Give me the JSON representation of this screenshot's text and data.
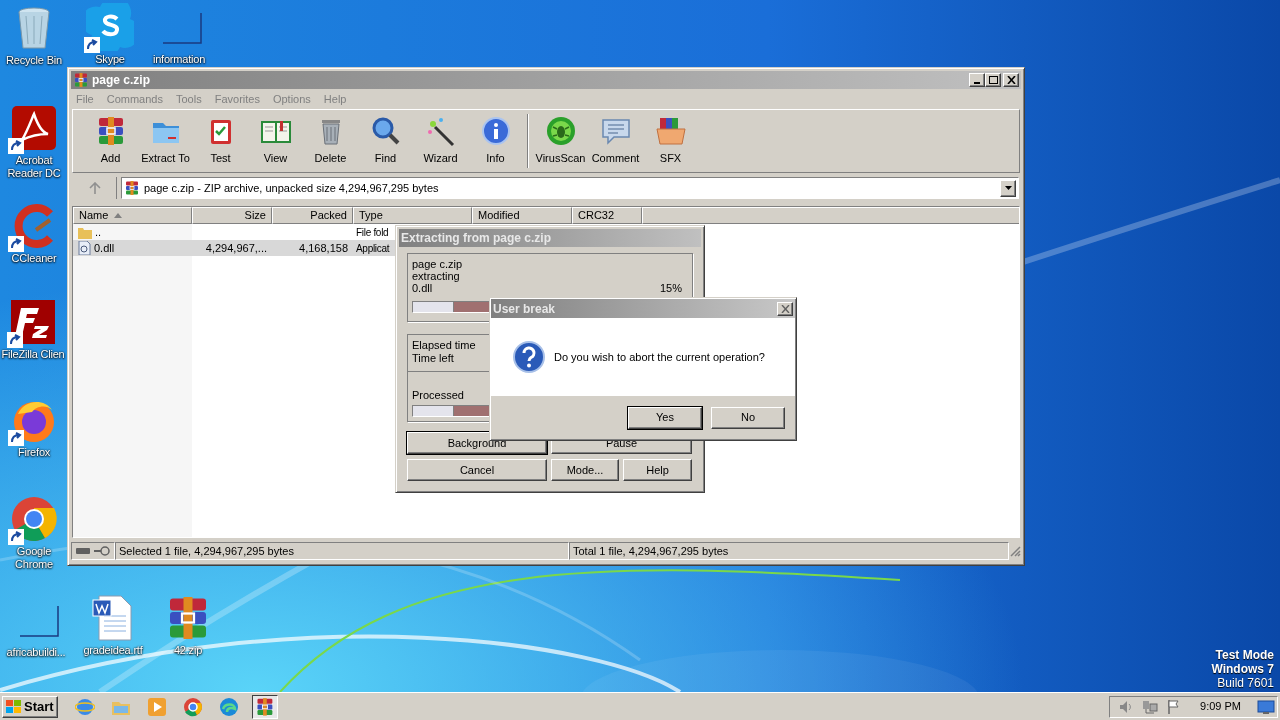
{
  "desktop_icons": [
    {
      "label": "Recycle Bin",
      "kind": "recycle",
      "shortcut": false
    },
    {
      "label": "Skype",
      "kind": "skype",
      "shortcut": true
    },
    {
      "label": "information",
      "kind": "blank",
      "shortcut": false
    },
    {
      "label": "Acrobat Reader DC",
      "kind": "acrobat",
      "shortcut": true
    },
    {
      "label": "CCleaner",
      "kind": "ccleaner",
      "shortcut": true
    },
    {
      "label": "FileZilla Clien",
      "kind": "filezilla",
      "shortcut": true
    },
    {
      "label": "Firefox",
      "kind": "firefox",
      "shortcut": true
    },
    {
      "label": "Google Chrome",
      "kind": "chrome",
      "shortcut": true
    },
    {
      "label": "africabuildi...",
      "kind": "blank",
      "shortcut": false
    },
    {
      "label": "gradeidea.rtf",
      "kind": "word",
      "shortcut": false
    },
    {
      "label": "42.zip",
      "kind": "winrar",
      "shortcut": false
    }
  ],
  "system_notice": [
    "Test Mode",
    "Windows 7",
    "Build 7601"
  ],
  "window": {
    "title": "page c.zip",
    "menu": [
      {
        "label": "File",
        "disabled": true
      },
      {
        "label": "Commands",
        "disabled": true
      },
      {
        "label": "Tools",
        "disabled": true
      },
      {
        "label": "Favorites",
        "disabled": true
      },
      {
        "label": "Options",
        "disabled": true
      },
      {
        "label": "Help",
        "disabled": true
      }
    ],
    "toolbar": [
      {
        "label": "Add",
        "kind": "add"
      },
      {
        "label": "Extract To",
        "kind": "extract"
      },
      {
        "label": "Test",
        "kind": "test"
      },
      {
        "label": "View",
        "kind": "view"
      },
      {
        "label": "Delete",
        "kind": "delete"
      },
      {
        "label": "Find",
        "kind": "find"
      },
      {
        "label": "Wizard",
        "kind": "wizard"
      },
      {
        "label": "Info",
        "kind": "info"
      },
      {
        "kind": "separator"
      },
      {
        "label": "VirusScan",
        "kind": "virus"
      },
      {
        "label": "Comment",
        "kind": "comment"
      },
      {
        "label": "SFX",
        "kind": "sfx"
      }
    ],
    "address": "page c.zip - ZIP archive, unpacked size 4,294,967,295 bytes",
    "table": {
      "columns": [
        {
          "label": "Name",
          "sorted": true
        },
        {
          "label": "Size",
          "sorted": false
        },
        {
          "label": "Packed",
          "sorted": false
        },
        {
          "label": "Type",
          "sorted": false
        },
        {
          "label": "Modified",
          "sorted": false
        },
        {
          "label": "CRC32",
          "sorted": false
        }
      ],
      "rows": [
        {
          "kind": "folder",
          "selected": false,
          "cells": [
            "..",
            "",
            "",
            "File fold"
          ]
        },
        {
          "kind": "file",
          "selected": true,
          "cells": [
            "0.dll",
            "4,294,967,...",
            "4,168,158",
            "Applicat"
          ]
        }
      ]
    },
    "status_bar": [
      "Selected 1 file, 4,294,967,295 bytes",
      "Total 1 file, 4,294,967,295 bytes"
    ]
  },
  "extract_dialog": {
    "title": "Extracting from page c.zip",
    "lines": [
      "page c.zip",
      "extracting",
      "0.dll"
    ],
    "percent": "15%",
    "file_progress": {
      "level": 0.15
    },
    "time_labels": [
      "Elapsed time",
      "Time left"
    ],
    "processed": {
      "label": "Processed",
      "level": 0.15
    },
    "buttons": [
      {
        "label": "Background",
        "default": true
      },
      {
        "label": "Pause",
        "default": false
      },
      {
        "label": "Cancel",
        "default": false
      },
      {
        "label": "Mode...",
        "default": false
      },
      {
        "label": "Help",
        "default": false
      }
    ]
  },
  "confirm_dialog": {
    "title": "User break",
    "message": "Do you wish to abort the current operation?",
    "buttons": [
      {
        "label": "Yes",
        "default": true
      },
      {
        "label": "No",
        "default": false
      }
    ]
  },
  "taskbar": {
    "start": "Start",
    "apps": [
      {
        "kind": "ie",
        "active": false
      },
      {
        "kind": "explorer",
        "active": false
      },
      {
        "kind": "media",
        "active": false
      },
      {
        "kind": "chrome",
        "active": false
      },
      {
        "kind": "edge",
        "active": false
      },
      {
        "kind": "winrar",
        "active": true
      }
    ],
    "clock": "9:09 PM"
  }
}
